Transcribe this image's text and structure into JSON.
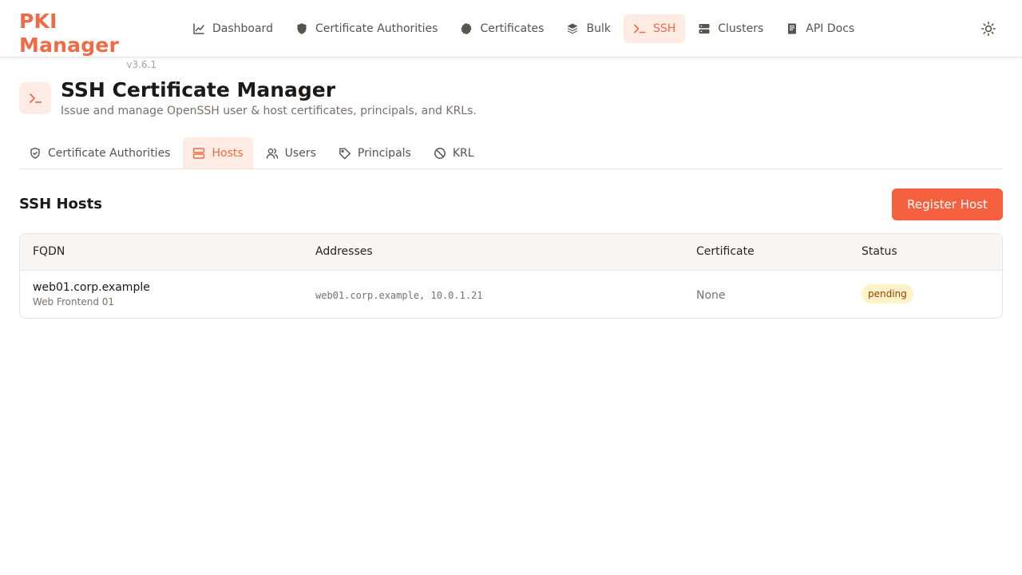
{
  "app": {
    "name": "PKI Manager",
    "version": "v3.6.1"
  },
  "nav": {
    "items": [
      {
        "label": "Dashboard",
        "icon": "chart-line-icon"
      },
      {
        "label": "Certificate Authorities",
        "icon": "shield-icon"
      },
      {
        "label": "Certificates",
        "icon": "seal-badge-icon"
      },
      {
        "label": "Bulk",
        "icon": "layers-icon"
      },
      {
        "label": "SSH",
        "icon": "terminal-icon",
        "active": true
      },
      {
        "label": "Clusters",
        "icon": "server-icon"
      },
      {
        "label": "API Docs",
        "icon": "book-icon"
      }
    ],
    "theme_icon": "sun-icon"
  },
  "page": {
    "title": "SSH Certificate Manager",
    "subtitle": "Issue and manage OpenSSH user & host certificates, principals, and KRLs.",
    "icon": "terminal-icon"
  },
  "subtabs": [
    {
      "label": "Certificate Authorities",
      "icon": "shield-check-icon"
    },
    {
      "label": "Hosts",
      "icon": "server-icon",
      "active": true
    },
    {
      "label": "Users",
      "icon": "users-icon"
    },
    {
      "label": "Principals",
      "icon": "tag-icon"
    },
    {
      "label": "KRL",
      "icon": "ban-icon"
    }
  ],
  "hosts": {
    "title": "SSH Hosts",
    "register_label": "Register Host",
    "columns": [
      "FQDN",
      "Addresses",
      "Certificate",
      "Status"
    ],
    "rows": [
      {
        "fqdn": "web01.corp.example",
        "name": "Web Frontend 01",
        "addresses": "web01.corp.example, 10.0.1.21",
        "certificate": "None",
        "status": "pending"
      }
    ]
  },
  "colors": {
    "accent": "#f06a45",
    "accent_soft": "#fdebe4",
    "button": "#f5603f",
    "badge_pending_bg": "#fef3c7",
    "badge_pending_text": "#92400e"
  }
}
